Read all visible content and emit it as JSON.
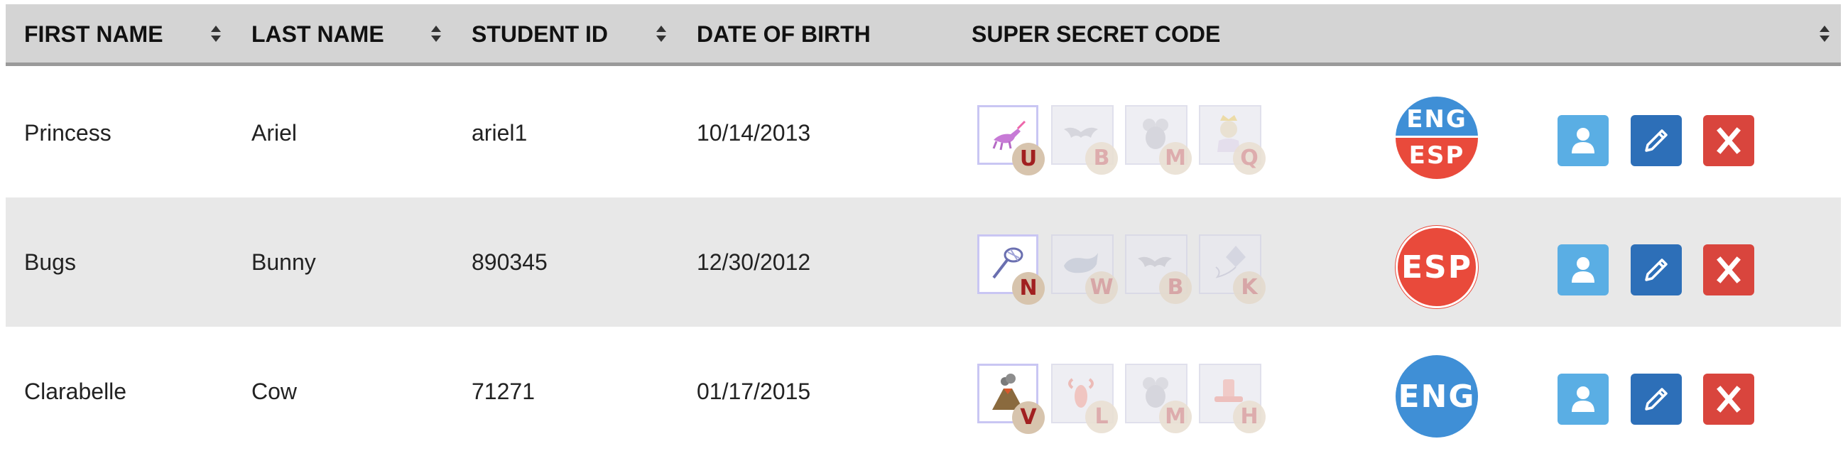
{
  "table": {
    "headers": [
      {
        "label": "FIRST NAME",
        "sortable": true
      },
      {
        "label": "LAST NAME",
        "sortable": true
      },
      {
        "label": "STUDENT ID",
        "sortable": true
      },
      {
        "label": "DATE OF BIRTH",
        "sortable": false
      },
      {
        "label": "SUPER SECRET CODE",
        "sortable": true
      }
    ],
    "rows": [
      {
        "first_name": "Princess",
        "last_name": "Ariel",
        "student_id": "ariel1",
        "dob": "10/14/2013",
        "code": [
          {
            "letter": "U",
            "icon": "unicorn-icon",
            "active": true
          },
          {
            "letter": "B",
            "icon": "bat-icon",
            "active": false
          },
          {
            "letter": "M",
            "icon": "mouse-icon",
            "active": false
          },
          {
            "letter": "Q",
            "icon": "queen-icon",
            "active": false
          }
        ],
        "language": {
          "type": "both",
          "top": "ENG",
          "bottom": "ESP"
        }
      },
      {
        "first_name": "Bugs",
        "last_name": "Bunny",
        "student_id": "890345",
        "dob": "12/30/2012",
        "code": [
          {
            "letter": "N",
            "icon": "net-icon",
            "active": true
          },
          {
            "letter": "W",
            "icon": "whale-icon",
            "active": false
          },
          {
            "letter": "B",
            "icon": "bat-icon",
            "active": false
          },
          {
            "letter": "K",
            "icon": "kite-icon",
            "active": false
          }
        ],
        "language": {
          "type": "esp",
          "label": "ESP"
        }
      },
      {
        "first_name": "Clarabelle",
        "last_name": "Cow",
        "student_id": "71271",
        "dob": "01/17/2015",
        "code": [
          {
            "letter": "V",
            "icon": "volcano-icon",
            "active": true
          },
          {
            "letter": "L",
            "icon": "lobster-icon",
            "active": false
          },
          {
            "letter": "M",
            "icon": "mouse-icon",
            "active": false
          },
          {
            "letter": "H",
            "icon": "hat-icon",
            "active": false
          }
        ],
        "language": {
          "type": "eng",
          "label": "ENG"
        }
      }
    ]
  },
  "actions": {
    "profile_icon": "user-profile-icon",
    "edit_icon": "pencil-icon",
    "delete_icon": "close-x-icon"
  },
  "colors": {
    "header_bg": "#d4d4d4",
    "alt_row_bg": "#e8e8e8",
    "eng_blue": "#3f8fd6",
    "esp_red": "#e94a3b",
    "profile_btn": "#5aaee4",
    "edit_btn": "#2d6fb8",
    "delete_btn": "#d9453d"
  }
}
